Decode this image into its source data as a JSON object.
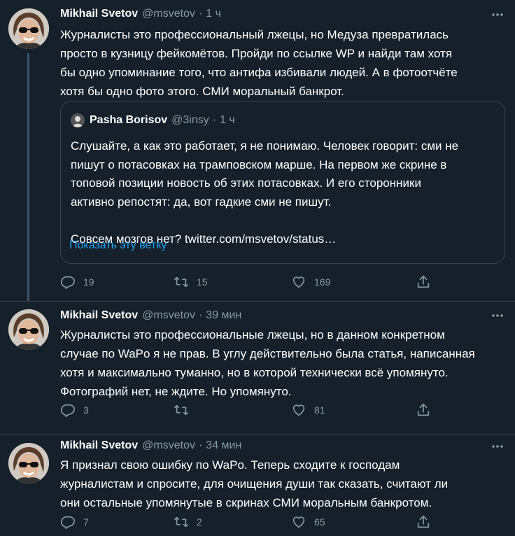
{
  "colors": {
    "background": "#15202b",
    "text": "#ffffff",
    "muted": "#8899a6",
    "link": "#1da1f2",
    "border": "#38444d"
  },
  "tweets": [
    {
      "name": "Mikhail Svetov",
      "handle": "@msvetov",
      "dot": "·",
      "time": "1 ч",
      "lines": [
        "Журналисты это профессиональный лжецы, но Медуза превратилась",
        "просто в кузницу фейкомётов. Пройди по ссылке WP и найди там хотя",
        "бы одно упоминание того, что антифа избивали людей. А в фотоотчёте",
        "хотя бы одно фото этого. СМИ моральный банкрот."
      ],
      "quote": {
        "name": "Pasha Borisov",
        "handle": "@3insy",
        "dot": "·",
        "time": "1 ч",
        "lines": [
          "Слушайте, а как это работает, я не понимаю. Человек говорит: сми не",
          "пишут о потасовках на трамповском марше. На первом же скрине в",
          "топовой позиции новость об этих потасовках. И его сторонники",
          "активно репостят: да, вот гадкие сми не пишут.",
          "",
          "Совсем мозгов нет? twitter.com/msvetov/status…"
        ],
        "show_thread": "Показать эту ветку"
      },
      "replies": "19",
      "retweets": "15",
      "likes": "169"
    },
    {
      "name": "Mikhail Svetov",
      "handle": "@msvetov",
      "dot": "·",
      "time": "39 мин",
      "lines": [
        "Журналисты это профессиональные лжецы, но в данном конкретном",
        "случае по WaPo я не прав. В углу действительно была статья, написанная",
        "хотя и максимально туманно, но в которой технически всё упомянуто.",
        "Фотографий нет, не ждите. Но упомянуто."
      ],
      "replies": "3",
      "retweets": "",
      "likes": "81"
    },
    {
      "name": "Mikhail Svetov",
      "handle": "@msvetov",
      "dot": "·",
      "time": "34 мин",
      "lines": [
        "Я признал свою ошибку по WaPo. Теперь сходите к господам",
        "журналистам и спросите, для очищения души так сказать, считают ли",
        "они остальные упомянутые в скринах СМИ моральным банкротом."
      ],
      "replies": "7",
      "retweets": "2",
      "likes": "65"
    }
  ]
}
